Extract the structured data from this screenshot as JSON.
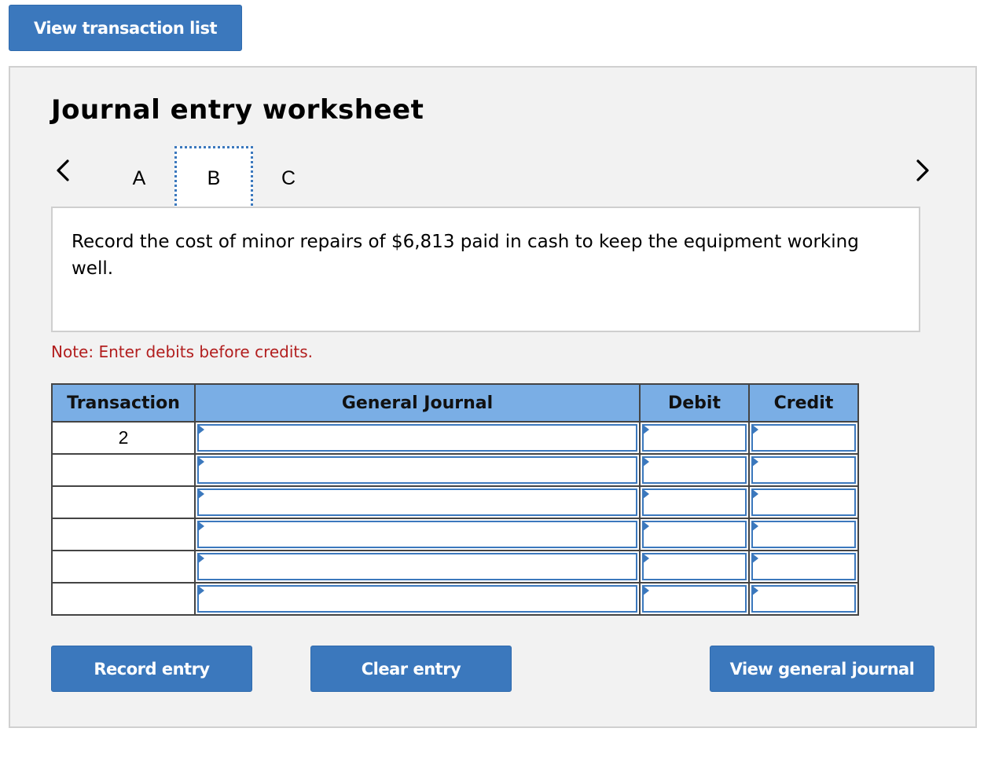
{
  "top_button": "View transaction list",
  "worksheet": {
    "title": "Journal entry worksheet",
    "tabs": [
      "A",
      "B",
      "C"
    ],
    "active_tab": "B",
    "prev_icon": "chevron-left-icon",
    "next_icon": "chevron-right-icon",
    "description": "Record the cost of minor repairs of $6,813 paid in cash to keep the equipment working well.",
    "note": "Note: Enter debits before credits."
  },
  "table": {
    "headers": [
      "Transaction",
      "General Journal",
      "Debit",
      "Credit"
    ],
    "rows": [
      {
        "transaction": "2",
        "account": "",
        "debit": "",
        "credit": ""
      },
      {
        "transaction": "",
        "account": "",
        "debit": "",
        "credit": ""
      },
      {
        "transaction": "",
        "account": "",
        "debit": "",
        "credit": ""
      },
      {
        "transaction": "",
        "account": "",
        "debit": "",
        "credit": ""
      },
      {
        "transaction": "",
        "account": "",
        "debit": "",
        "credit": ""
      },
      {
        "transaction": "",
        "account": "",
        "debit": "",
        "credit": ""
      }
    ]
  },
  "buttons": {
    "record": "Record entry",
    "clear": "Clear entry",
    "view_journal": "View general journal"
  },
  "colors": {
    "accent": "#3b78bd",
    "header_bg": "#7aaee5",
    "note": "#b21e1e",
    "panel_bg": "#f2f2f2"
  }
}
